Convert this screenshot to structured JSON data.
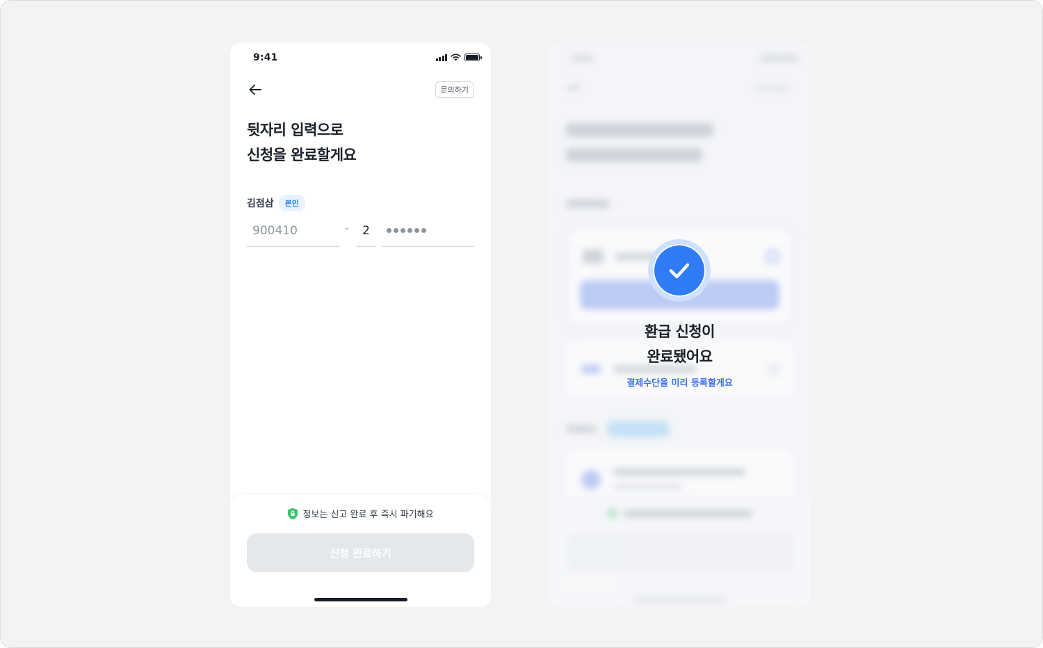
{
  "status_bar": {
    "time": "9:41"
  },
  "left_screen": {
    "header": {
      "inquiry_label": "문의하기"
    },
    "title_line1": "뒷자리 입력으로",
    "title_line2": "신청을 완료할게요",
    "name": "김점삼",
    "name_badge": "본인",
    "birth_date": "900410",
    "separator": "-",
    "gender_digit": "2",
    "masked_digits": 6,
    "notice_text": "정보는 신고 완료 후 즉시 파기해요",
    "submit_label": "신청 완료하기"
  },
  "right_screen": {
    "success_title_line1": "환급 신청이",
    "success_title_line2": "완료됐어요",
    "success_link": "결제수단을 미리 등록할게요"
  },
  "colors": {
    "accent": "#3182f6",
    "check_blue": "#2f7cf6",
    "badge_bg": "#e8f3ff",
    "disabled_button": "#e5e8eb",
    "shield_green": "#35c46a"
  },
  "icons": {
    "back": "arrow-left-icon",
    "shield": "shield-lock-icon",
    "check": "check-icon",
    "signal": "signal-icon",
    "wifi": "wifi-icon",
    "battery": "battery-icon"
  }
}
